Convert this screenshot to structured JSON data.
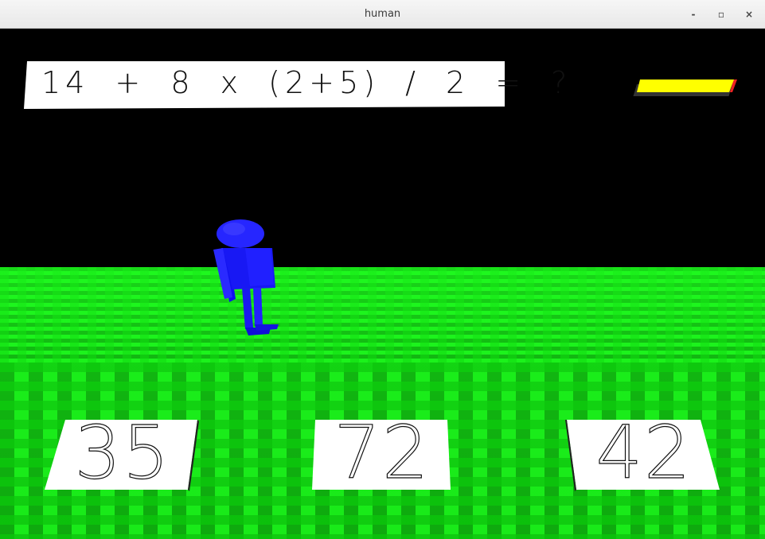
{
  "window": {
    "title": "human",
    "controls": {
      "minimize": "-",
      "maximize": "▫",
      "close": "×"
    }
  },
  "question": {
    "text": "14 + 8 x (2+5) / 2 = ?"
  },
  "hud": {
    "indicator_colors": [
      "#22dd22",
      "#ee2222"
    ],
    "bar_color": "#ffff00"
  },
  "answers": [
    {
      "label": "35"
    },
    {
      "label": "72"
    },
    {
      "label": "42"
    }
  ],
  "colors": {
    "sky": "#000000",
    "ground": "#11dd11",
    "character": "#1a1aff",
    "card": "#ffffff"
  }
}
